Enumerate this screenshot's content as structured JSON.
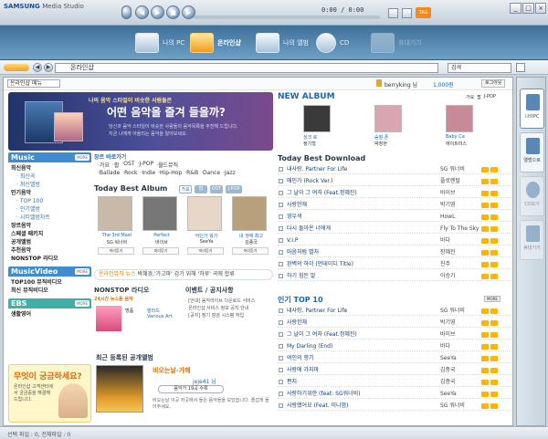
{
  "app": {
    "brand": "SAMSUNG",
    "name": "Media Studio",
    "time": "0:00 / 0:00",
    "tag": "TAG"
  },
  "nav": {
    "tabs": [
      {
        "label": "나의 PC"
      },
      {
        "label": "온라인샵"
      },
      {
        "label": "나의 앨범"
      },
      {
        "label": "CD"
      },
      {
        "label": "휴대기기"
      }
    ]
  },
  "address": {
    "location": "온라인샵",
    "search": "검색"
  },
  "top": {
    "category": "온라인샵 메뉴",
    "user": "berryking 님",
    "cash": "1,000원",
    "logout": "로그아웃",
    "links": "도움말 | 이용약관"
  },
  "banner": {
    "line1": "나의 음악 스타일이 비슷한 사람들은",
    "line2": "어떤 음악을 즐겨 들을까?",
    "line3": "당신과 음악 스타일이 비슷한 사람들의 음악목록을 추천해 드립니다.",
    "line4": "지금 나에게 어울리는 음악을 알아보세요."
  },
  "sidebar": {
    "music_title": "Music",
    "more": "MORE",
    "music_items": [
      {
        "label": "최신음악",
        "kind": "bold"
      },
      {
        "label": "최신곡",
        "kind": "sub"
      },
      {
        "label": "최신앨범",
        "kind": "sub"
      },
      {
        "label": "인기음악",
        "kind": "bold"
      },
      {
        "label": "TOP 100",
        "kind": "sub"
      },
      {
        "label": "인기앨범",
        "kind": "sub"
      },
      {
        "label": "시티앨범차트",
        "kind": "sub"
      },
      {
        "label": "장르음악",
        "kind": "bold"
      },
      {
        "label": "스페셜 패키지",
        "kind": "bold"
      },
      {
        "label": "공개앨범",
        "kind": "bold"
      },
      {
        "label": "추천음악",
        "kind": "bold"
      },
      {
        "label": "NONSTOP 라디오",
        "kind": "bold"
      }
    ],
    "mv_title": "MusicVideo",
    "mv_items": [
      {
        "label": "TOP100 뮤직비디오"
      },
      {
        "label": "최신 뮤직비디오"
      }
    ],
    "ebs_title": "EBS",
    "ebs_items": [
      {
        "label": "생활영어"
      }
    ],
    "ad_title": "무엇이 궁금하세요?",
    "ad_text": "온라인샵 고객센터에서 궁금증을 해결해 드립니다."
  },
  "genre": {
    "title": "장르 바로가기",
    "tags_row1": [
      "가요",
      "팝",
      "OST",
      "J-POP",
      "월드뮤직"
    ],
    "tags_row2": [
      "Ballade",
      "Rock",
      "Indie",
      "Hip-Hop",
      "R&B",
      "Dance",
      "Jazz"
    ]
  },
  "album": {
    "title": "Today Best Album",
    "tabs": [
      "가요",
      "팝",
      "OST",
      "J-POP"
    ],
    "items": [
      {
        "title": "The 3rd Mast",
        "artist": "SG 워너비",
        "btn": "미리듣기"
      },
      {
        "title": "Perfect",
        "artist": "바이브",
        "btn": "미리듣기"
      },
      {
        "title": "어딘가 왕기",
        "artist": "SeeYa",
        "btn": "미리듣기"
      },
      {
        "title": "내 생애 최고",
        "artist": "김종국",
        "btn": "미리듣기"
      }
    ]
  },
  "news": {
    "label": "온라인뮤직 뉴스",
    "text": "박혜경,'가고파' 감기 위해 '하루' 곡에 합류"
  },
  "radio": {
    "title": "NONSTOP 라디오",
    "sub": "24시간 뉴스듣 음악",
    "song": "명품",
    "artist": "Various Art",
    "type": "발라드"
  },
  "event": {
    "title": "이벤트 / 공지사항",
    "items": [
      "[안내] 음악라이브 다운로드 서비스",
      "온라인샵 서비스 정보 공지 안내",
      "[공지] 정기 점검 시스템 작업"
    ]
  },
  "public": {
    "title": "최근 등록된 공개앨범",
    "album_name": "비오는날-가해",
    "owner": "jeje41 님",
    "count": "음악가 19곡 수록",
    "desc": "비오는날 이곳 저곳에서 들은 음악들을 모았습니다. 즐겁게 들어주세요."
  },
  "newalbum": {
    "title": "NEW ALBUM",
    "filters": [
      "가요",
      "팝",
      "J-POP"
    ],
    "items": [
      {
        "title": "싱크 로",
        "artist": "정기형"
      },
      {
        "title": "숨쉴 폰",
        "artist": "박정현"
      },
      {
        "title": "Baby Ca",
        "artist": "에이트마스"
      }
    ]
  },
  "download": {
    "title": "Today Best Download",
    "songs": [
      {
        "title": "내사랑. Partner For Life",
        "artist": "SG 워너비"
      },
      {
        "title": "애인가 (Rock Ver.)",
        "artist": "플로렌탈"
      },
      {
        "title": "그 날이 그 여자 (Feat.정혜진)",
        "artist": "바이브"
      },
      {
        "title": "사랑한채",
        "artist": "박기영"
      },
      {
        "title": "영우색",
        "artist": "HowL"
      },
      {
        "title": "다시 돌아온 너에게",
        "artist": "Fly To The Sky"
      },
      {
        "title": "V.I.P",
        "artist": "바다"
      },
      {
        "title": "마음처럼 별처",
        "artist": "장혜진"
      },
      {
        "title": "완벽의 하이 (먼데이디 Title)",
        "artist": "진주"
      },
      {
        "title": "하기 힘든 말",
        "artist": "이승기"
      }
    ]
  },
  "top10": {
    "title": "인기 TOP 10",
    "songs": [
      {
        "title": "내사랑. Partner For Life",
        "artist": "SG 워너비"
      },
      {
        "title": "사랑한채",
        "artist": "박기영"
      },
      {
        "title": "그 날이 그 여자 (Feat.정혜진)",
        "artist": "바이브"
      },
      {
        "title": "My Darling (End)",
        "artist": "바다"
      },
      {
        "title": "여인의 향기",
        "artist": "SeeYa"
      },
      {
        "title": "사랑에 가지마",
        "artist": "김종국"
      },
      {
        "title": "편지",
        "artist": "김종국"
      },
      {
        "title": "사랑하기위한 (feat: SG워너비)",
        "artist": "SeeYa"
      },
      {
        "title": "사랑했어요 (Feat. 미니멈)",
        "artist": "SG 워너비"
      }
    ]
  },
  "dock": {
    "items": [
      "나의PC",
      "앨범으로",
      "CD보기",
      "휴대기기"
    ]
  },
  "status": {
    "text": "선택 파일 : 0, 전체파일 : 0"
  }
}
